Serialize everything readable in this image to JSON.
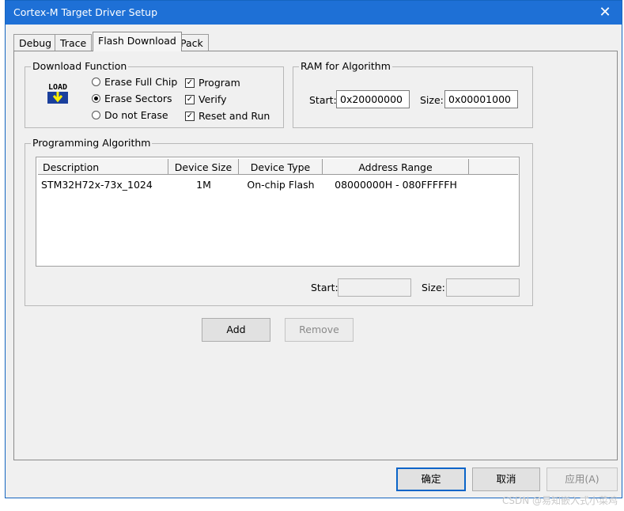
{
  "window": {
    "title": "Cortex-M Target Driver Setup",
    "close_glyph": "✕"
  },
  "tabs": [
    {
      "label": "Debug",
      "active": false
    },
    {
      "label": "Trace",
      "active": false
    },
    {
      "label": "Flash Download",
      "active": true
    },
    {
      "label": "Pack",
      "active": false
    }
  ],
  "download_function": {
    "title": "Download Function",
    "load_icon_text": "LOAD",
    "options": [
      {
        "label": "Erase Full Chip",
        "selected": false
      },
      {
        "label": "Erase Sectors",
        "selected": true
      },
      {
        "label": "Do not Erase",
        "selected": false
      }
    ],
    "checks": [
      {
        "label": "Program",
        "checked": true
      },
      {
        "label": "Verify",
        "checked": true
      },
      {
        "label": "Reset and Run",
        "checked": true
      }
    ]
  },
  "ram": {
    "title": "RAM for Algorithm",
    "start_label": "Start:",
    "start_value": "0x20000000",
    "size_label": "Size:",
    "size_value": "0x00001000"
  },
  "algorithm": {
    "title": "Programming Algorithm",
    "columns": [
      "Description",
      "Device Size",
      "Device Type",
      "Address Range"
    ],
    "rows": [
      [
        "STM32H72x-73x_1024",
        "1M",
        "On-chip Flash",
        "08000000H - 080FFFFFH"
      ]
    ],
    "start_label": "Start:",
    "start_value": "",
    "size_label": "Size:",
    "size_value": ""
  },
  "buttons": {
    "add": "Add",
    "remove": "Remove"
  },
  "footer": {
    "ok": "确定",
    "cancel": "取消",
    "apply": "应用(A)"
  },
  "watermark": "CSDN @易知嵌入式小菜鸡",
  "colors": {
    "titlebar": "#1e70d6",
    "accent_border": "#0a64c8"
  }
}
